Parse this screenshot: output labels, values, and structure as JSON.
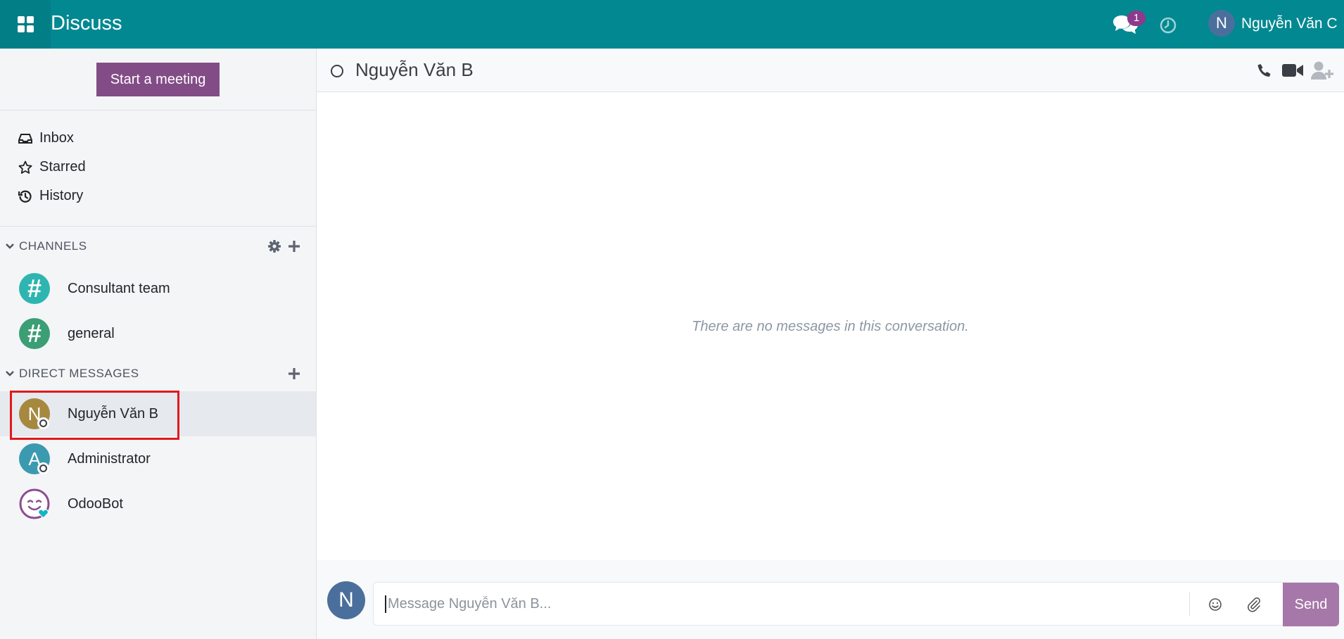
{
  "app": {
    "title": "Discuss"
  },
  "navbar": {
    "chat_badge": "1",
    "user_initial": "N",
    "user_name": "Nguyễn Văn C"
  },
  "sidebar": {
    "start_meeting": "Start a meeting",
    "mailboxes": [
      {
        "label": "Inbox",
        "icon": "inbox-icon"
      },
      {
        "label": "Starred",
        "icon": "star-icon"
      },
      {
        "label": "History",
        "icon": "history-icon"
      }
    ],
    "channels_header": "CHANNELS",
    "channels": [
      {
        "label": "Consultant team",
        "color": "#2fb5b1"
      },
      {
        "label": "general",
        "color": "#3b9e74"
      }
    ],
    "dm_header": "DIRECT MESSAGES",
    "direct_messages": [
      {
        "initial": "N",
        "label": "Nguyễn Văn B",
        "color": "#a6883f"
      },
      {
        "initial": "A",
        "label": "Administrator",
        "color": "#3b9ab0"
      },
      {
        "label": "OdooBot"
      }
    ]
  },
  "thread": {
    "name": "Nguyễn Văn B",
    "empty_text": "There are no messages in this conversation.",
    "composer_initial": "N",
    "composer_placeholder": "Message Nguyễn Văn B...",
    "send_label": "Send"
  },
  "colors": {
    "navbar": "#028891",
    "brand_purple": "#824c86",
    "highlight": "#e2191b"
  }
}
